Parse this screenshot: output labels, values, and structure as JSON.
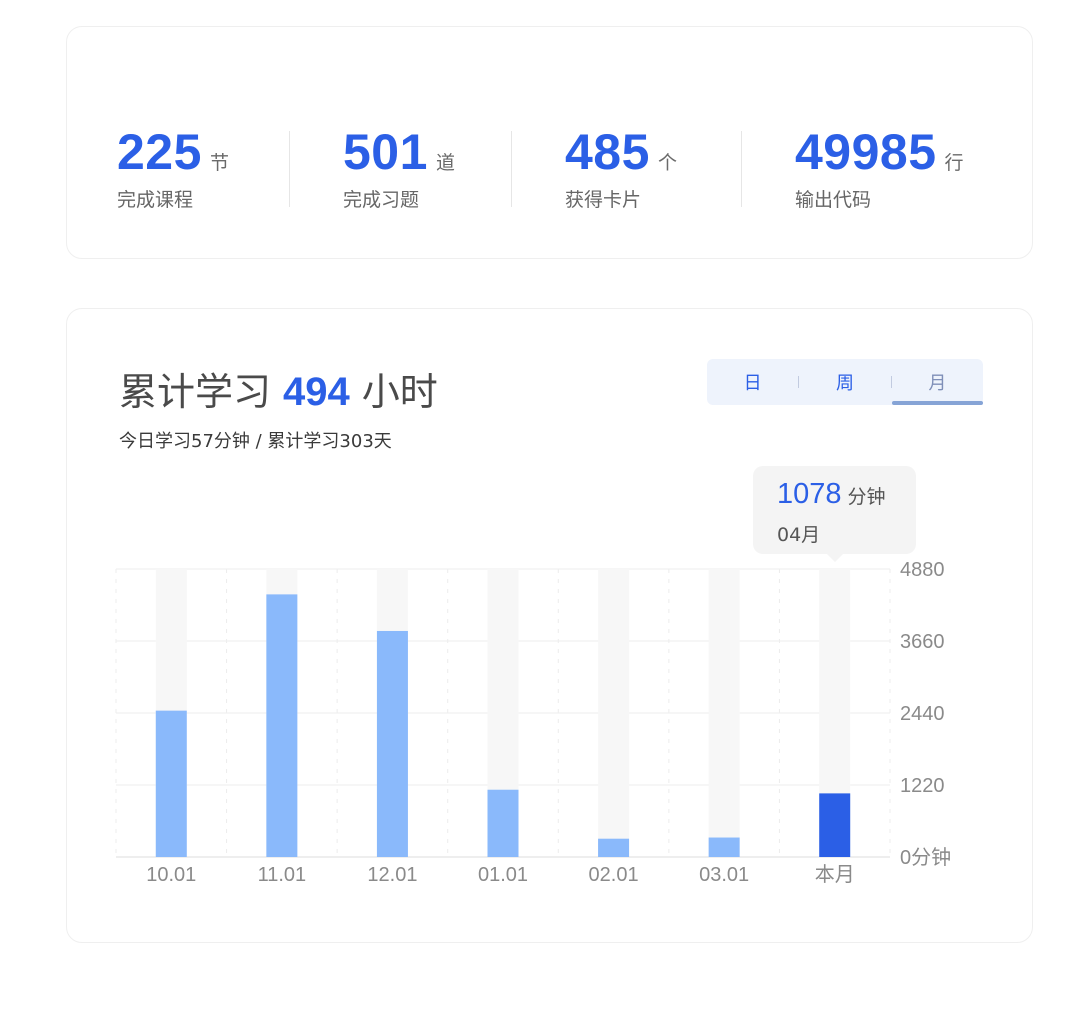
{
  "stats": [
    {
      "value": "225",
      "unit": "节",
      "label": "完成课程"
    },
    {
      "value": "501",
      "unit": "道",
      "label": "完成习题"
    },
    {
      "value": "485",
      "unit": "个",
      "label": "获得卡片"
    },
    {
      "value": "49985",
      "unit": "行",
      "label": "输出代码"
    }
  ],
  "study": {
    "title_prefix": "累计学习",
    "hours": "494",
    "title_suffix": "小时",
    "subtitle": "今日学习57分钟 / 累计学习303天"
  },
  "tabs": [
    {
      "label": "日",
      "active": false
    },
    {
      "label": "周",
      "active": false
    },
    {
      "label": "月",
      "active": true
    }
  ],
  "tooltip": {
    "value": "1078",
    "unit": "分钟",
    "category": "04月"
  },
  "colors": {
    "accent": "#2b5fe6",
    "bar": "#8ab9fb",
    "bar_highlight": "#2b5fe6",
    "track": "#f7f7f7"
  },
  "chart_data": {
    "type": "bar",
    "categories": [
      "10.01",
      "11.01",
      "12.01",
      "01.01",
      "02.01",
      "03.01",
      "本月"
    ],
    "values": [
      2480,
      4450,
      3830,
      1140,
      310,
      330,
      1078
    ],
    "highlight_index": 6,
    "y_ticks": [
      "0分钟",
      "1220",
      "2440",
      "3660",
      "4880"
    ],
    "y_tick_values": [
      0,
      1220,
      2440,
      3660,
      4880
    ],
    "ylim": [
      0,
      4880
    ],
    "grid": true,
    "y_axis_position": "right"
  }
}
